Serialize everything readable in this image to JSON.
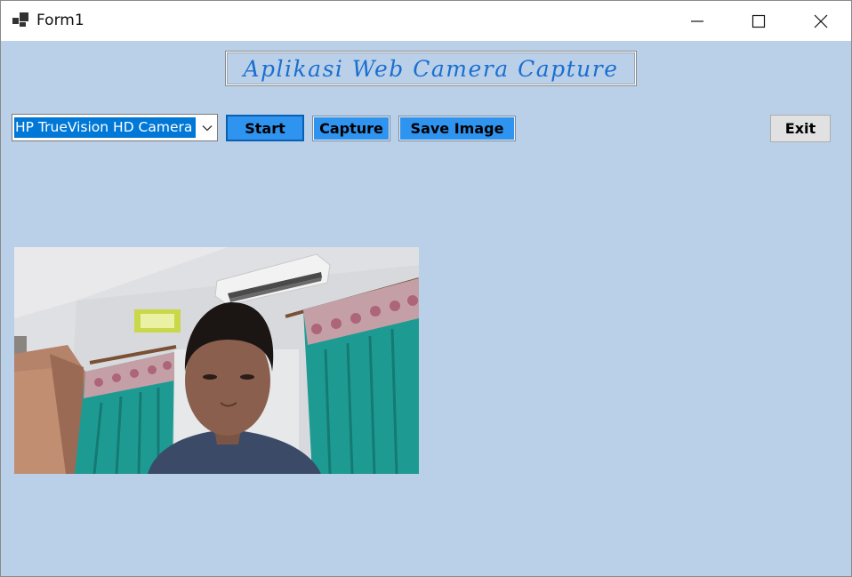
{
  "window": {
    "title": "Form1",
    "controls": [
      "minimize",
      "maximize",
      "close"
    ]
  },
  "app": {
    "heading": "Aplikasi Web Camera Capture"
  },
  "camera_select": {
    "selected": "HP TrueVision HD Camera"
  },
  "buttons": {
    "start": "Start",
    "capture": "Capture",
    "save": "Save Image",
    "exit": "Exit"
  },
  "colors": {
    "form_background": "#bad0e8",
    "heading_text": "#1b6fd0",
    "button_blue": "#2f93f0",
    "selection": "#0078d7"
  },
  "icons": {
    "app": "app-window-icon",
    "minimize": "minimize-icon",
    "maximize": "maximize-icon",
    "close": "close-icon",
    "dropdown": "chevron-down-icon"
  }
}
